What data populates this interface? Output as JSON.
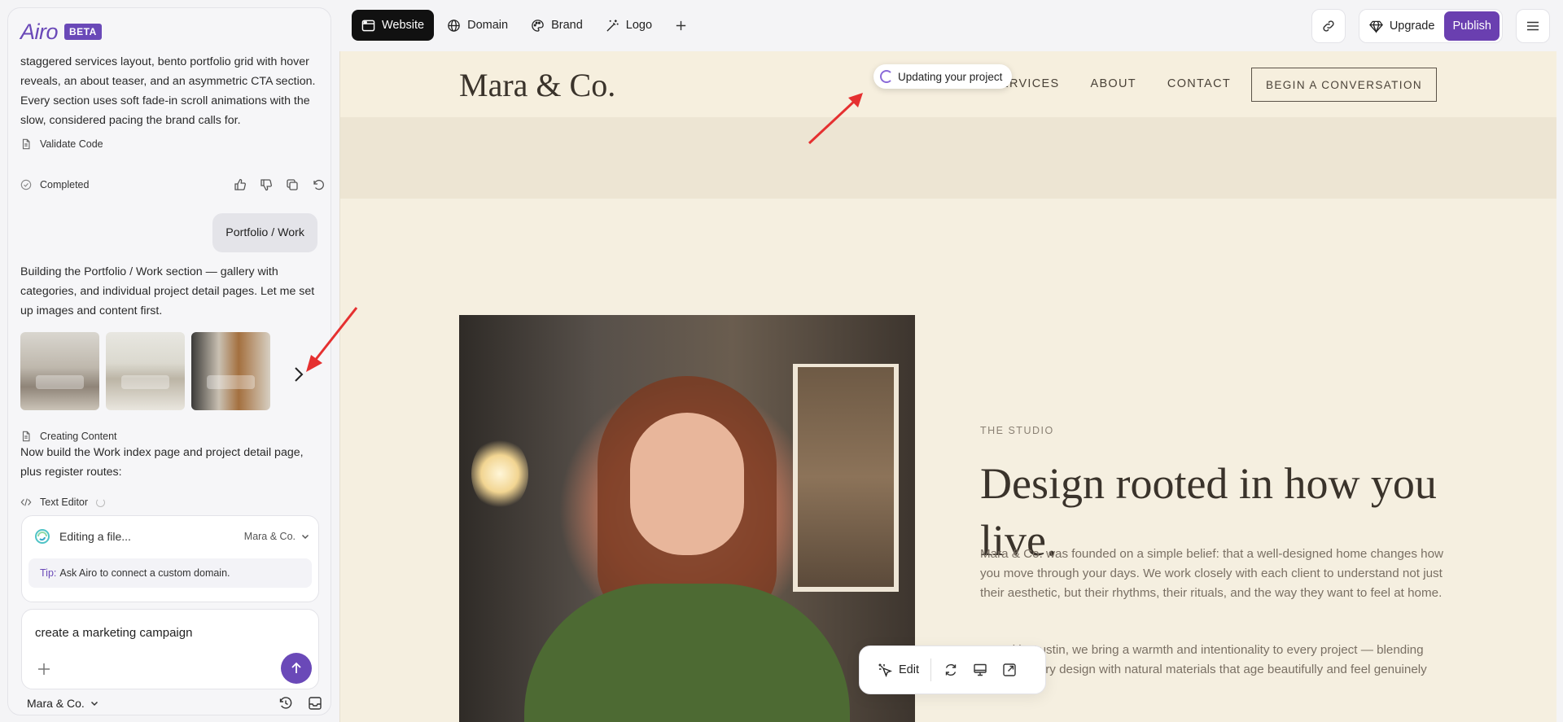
{
  "brand": {
    "logo": "Airo",
    "badge": "BETA",
    "accent": "#6a49b8"
  },
  "chat": {
    "message1": "staggered services layout, bento portfolio grid with hover reveals, an about teaser, and an asymmetric CTA section. Every section uses soft fade-in scroll animations with the slow, considered pacing the brand calls for.",
    "validate_label": "Validate Code",
    "completed_label": "Completed",
    "user_message": "Portfolio / Work",
    "message2": "Building the Portfolio / Work section — gallery with categories, and individual project detail pages. Let me set up images and content first.",
    "creating_label": "Creating Content",
    "message3": "Now build the Work index page and project detail page, plus register routes:",
    "text_editor_label": "Text Editor"
  },
  "status": {
    "title": "Editing a file...",
    "project": "Mara & Co.",
    "tip_label": "Tip:",
    "tip_text": "Ask Airo to connect a custom domain."
  },
  "composer": {
    "value": "create a marketing campaign"
  },
  "footer": {
    "project": "Mara & Co."
  },
  "topbar": {
    "tabs": [
      "Website",
      "Domain",
      "Brand",
      "Logo"
    ],
    "upgrade": "Upgrade",
    "publish": "Publish"
  },
  "site": {
    "logo": "Mara & Co.",
    "nav": [
      "SERVICES",
      "ABOUT",
      "CONTACT"
    ],
    "cta": "BEGIN A CONVERSATION",
    "eyebrow": "THE STUDIO",
    "heading": "Design rooted in how you live.",
    "p1": "Mara & Co. was founded on a simple belief: that a well-designed home changes how you move through your days. We work closely with each client to understand not just their aesthetic, but their rhythms, their rituals, and the way they want to feel at home.",
    "p2": "Based in Austin, we bring a warmth and intentionality to every project — blending contemporary design with natural materials that age beautifully and feel genuinely"
  },
  "preview": {
    "updating": "Updating your project",
    "edit": "Edit"
  }
}
